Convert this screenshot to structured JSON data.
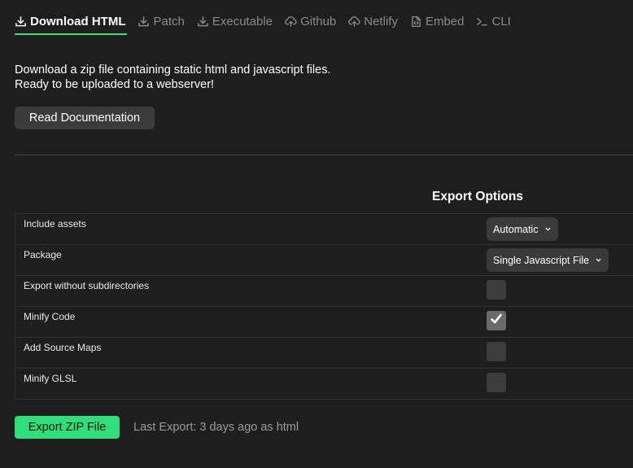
{
  "tabs": [
    {
      "label": "Download HTML",
      "icon": "download-icon",
      "active": true
    },
    {
      "label": "Patch",
      "icon": "download-icon"
    },
    {
      "label": "Executable",
      "icon": "download-icon"
    },
    {
      "label": "Github",
      "icon": "cloud-upload-icon"
    },
    {
      "label": "Netlify",
      "icon": "cloud-upload-icon"
    },
    {
      "label": "Embed",
      "icon": "code-file-icon"
    },
    {
      "label": "CLI",
      "icon": "terminal-icon"
    }
  ],
  "description": {
    "line1": "Download a zip file containing static html and javascript files.",
    "line2": "Ready to be uploaded to a webserver!"
  },
  "read_docs_label": "Read Documentation",
  "export_options": {
    "title": "Export Options",
    "rows": [
      {
        "label": "Include assets",
        "type": "select",
        "value": "Automatic"
      },
      {
        "label": "Package",
        "type": "select",
        "value": "Single Javascript File"
      },
      {
        "label": "Export without subdirectories",
        "type": "checkbox",
        "checked": false
      },
      {
        "label": "Minify Code",
        "type": "checkbox",
        "checked": true
      },
      {
        "label": "Add Source Maps",
        "type": "checkbox",
        "checked": false
      },
      {
        "label": "Minify GLSL",
        "type": "checkbox",
        "checked": false
      }
    ]
  },
  "footer": {
    "export_label": "Export ZIP File",
    "last_export": "Last Export: 3 days ago as html"
  },
  "colors": {
    "accent": "#2ee37a",
    "background": "#1e1e1e"
  }
}
